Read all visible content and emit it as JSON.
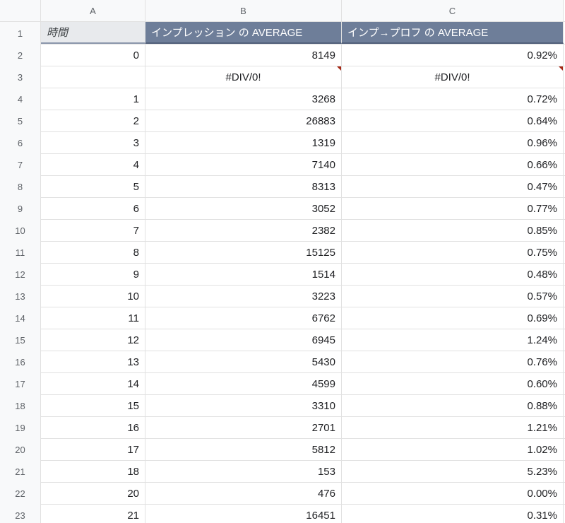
{
  "columns": {
    "A": "A",
    "B": "B",
    "C": "C"
  },
  "header": {
    "a": "時間",
    "b": "インプレッション の AVERAGE",
    "c": "インプ→プロフ の AVERAGE"
  },
  "rows": [
    {
      "n": "1"
    },
    {
      "n": "2",
      "a": "0",
      "b": "8149",
      "c": "0.92%"
    },
    {
      "n": "3",
      "a": "",
      "b": "#DIV/0!",
      "c": "#DIV/0!",
      "err": true,
      "center": true
    },
    {
      "n": "4",
      "a": "1",
      "b": "3268",
      "c": "0.72%"
    },
    {
      "n": "5",
      "a": "2",
      "b": "26883",
      "c": "0.64%"
    },
    {
      "n": "6",
      "a": "3",
      "b": "1319",
      "c": "0.96%"
    },
    {
      "n": "7",
      "a": "4",
      "b": "7140",
      "c": "0.66%"
    },
    {
      "n": "8",
      "a": "5",
      "b": "8313",
      "c": "0.47%"
    },
    {
      "n": "9",
      "a": "6",
      "b": "3052",
      "c": "0.77%"
    },
    {
      "n": "10",
      "a": "7",
      "b": "2382",
      "c": "0.85%"
    },
    {
      "n": "11",
      "a": "8",
      "b": "15125",
      "c": "0.75%"
    },
    {
      "n": "12",
      "a": "9",
      "b": "1514",
      "c": "0.48%"
    },
    {
      "n": "13",
      "a": "10",
      "b": "3223",
      "c": "0.57%"
    },
    {
      "n": "14",
      "a": "11",
      "b": "6762",
      "c": "0.69%"
    },
    {
      "n": "15",
      "a": "12",
      "b": "6945",
      "c": "1.24%"
    },
    {
      "n": "16",
      "a": "13",
      "b": "5430",
      "c": "0.76%"
    },
    {
      "n": "17",
      "a": "14",
      "b": "4599",
      "c": "0.60%"
    },
    {
      "n": "18",
      "a": "15",
      "b": "3310",
      "c": "0.88%"
    },
    {
      "n": "19",
      "a": "16",
      "b": "2701",
      "c": "1.21%"
    },
    {
      "n": "20",
      "a": "17",
      "b": "5812",
      "c": "1.02%"
    },
    {
      "n": "21",
      "a": "18",
      "b": "153",
      "c": "5.23%"
    },
    {
      "n": "22",
      "a": "20",
      "b": "476",
      "c": "0.00%"
    },
    {
      "n": "23",
      "a": "21",
      "b": "16451",
      "c": "0.31%"
    }
  ]
}
